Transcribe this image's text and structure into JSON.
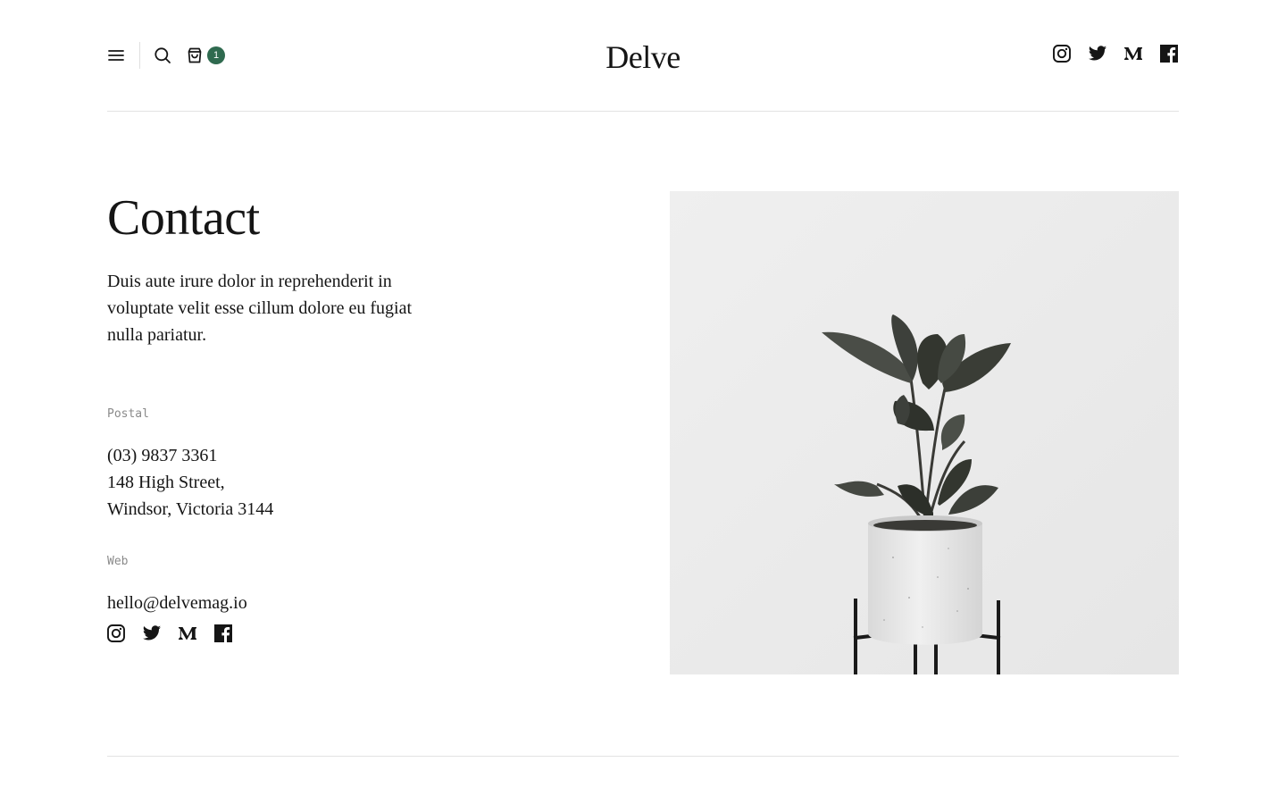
{
  "header": {
    "logo": "Delve",
    "cart_count": "1",
    "accent_color": "#2f6a4f",
    "icons": [
      "menu-icon",
      "search-icon",
      "shopping-bag-icon",
      "instagram-icon",
      "twitter-icon",
      "medium-icon",
      "facebook-icon"
    ]
  },
  "contact": {
    "title": "Contact",
    "intro": "Duis aute irure dolor in reprehenderit in voluptate velit esse cillum dolore eu fugiat nulla pariatur.",
    "postal_label": "Postal",
    "phone": "(03) 9837 3361",
    "street": "148 High Street,",
    "city": "Windsor, Victoria 3144",
    "web_label": "Web",
    "email": "hello@delvemag.io"
  },
  "image": {
    "subject": "potted rubber plant on black metal stand against white wall"
  }
}
